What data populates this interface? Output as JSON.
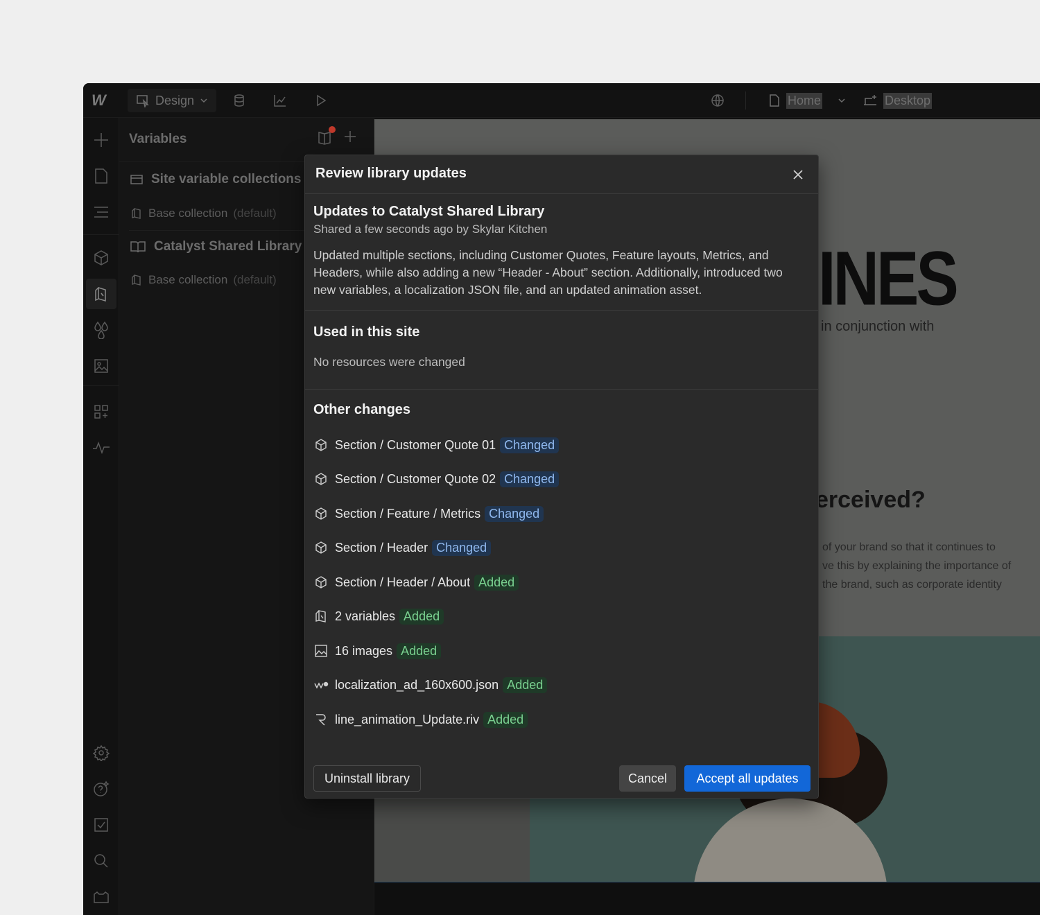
{
  "topbar": {
    "mode_label": "Design",
    "page_name": "Home",
    "breakpoint_name": "Desktop"
  },
  "panel": {
    "title": "Variables",
    "groups": [
      {
        "label": "Site variable collections",
        "items": [
          {
            "name": "Base collection",
            "suffix": "(default)"
          }
        ]
      },
      {
        "label": "Catalyst Shared Library",
        "items": [
          {
            "name": "Base collection",
            "suffix": "(default)"
          }
        ]
      }
    ]
  },
  "canvas": {
    "headline": "INES",
    "subtext": "in conjunction with",
    "question": "erceived?",
    "paragraph_lines": [
      "of your brand so that it continues to",
      "ve this by explaining the importance of",
      "the brand, such as corporate identity"
    ]
  },
  "modal": {
    "title": "Review library updates",
    "library_heading": "Updates to Catalyst Shared Library",
    "shared_by": "Shared a few seconds ago by Skylar Kitchen",
    "description": "Updated multiple sections, including Customer Quotes, Feature layouts, Metrics, and Headers, while also adding a new “Header - About” section. Additionally, introduced two new variables, a localization JSON file, and an updated animation asset.",
    "used_title": "Used in this site",
    "used_note": "No resources were changed",
    "other_title": "Other changes",
    "changes": [
      {
        "icon": "component-icon",
        "label": "Section / Customer Quote 01",
        "status": "Changed"
      },
      {
        "icon": "component-icon",
        "label": "Section / Customer Quote 02",
        "status": "Changed"
      },
      {
        "icon": "component-icon",
        "label": "Section / Feature / Metrics",
        "status": "Changed"
      },
      {
        "icon": "component-icon",
        "label": "Section / Header",
        "status": "Changed"
      },
      {
        "icon": "component-icon",
        "label": "Section / Header / About",
        "status": "Added"
      },
      {
        "icon": "variables-icon",
        "label": "2 variables",
        "status": "Added"
      },
      {
        "icon": "image-icon",
        "label": "16 images",
        "status": "Added"
      },
      {
        "icon": "lottie-icon",
        "label": "localization_ad_160x600.json",
        "status": "Added"
      },
      {
        "icon": "rive-icon",
        "label": "line_animation_Update.riv",
        "status": "Added"
      }
    ],
    "uninstall_label": "Uninstall library",
    "cancel_label": "Cancel",
    "accept_label": "Accept all updates"
  },
  "colors": {
    "accent": "#1267d8",
    "changed_badge_bg": "#203550",
    "changed_badge_text": "#8fb8ee",
    "added_badge_bg": "#1f3a28",
    "added_badge_text": "#79d08f"
  }
}
